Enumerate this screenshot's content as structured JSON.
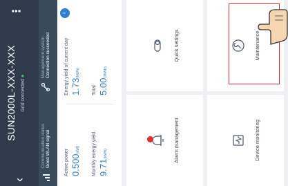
{
  "header": {
    "device_name": "SUN2000L-XXX-XXX",
    "grid_status": "Grid connected"
  },
  "status_bar": {
    "communication_label": "Communication status",
    "communication_value": "Good WLAN signal",
    "management_label": "Management system",
    "management_value": "Connection succeeded"
  },
  "energy": {
    "active_power_label": "Active power",
    "active_power_value": "0.500",
    "active_power_unit": "(kW)",
    "energy_today_label": "Energy yield of current day",
    "energy_today_value": "1.73",
    "energy_today_unit": "(kWh)",
    "monthly_label": "Monthly energy yield",
    "monthly_value": "9.71",
    "monthly_unit": "(kWh)",
    "total_label": "Total",
    "total_value": "5.00",
    "total_unit": "(MWh)",
    "badge_symbol": "i"
  },
  "tiles": {
    "alarm_management": "Alarm management",
    "quick_settings": "Quick settings",
    "device_monitoring": "Device monitoring",
    "maintenance": "Maintenance"
  },
  "icons": [
    "back-icon",
    "more-icon",
    "wlan-signal-icon",
    "link-icon",
    "alarm-icon",
    "quick-settings-icon",
    "device-monitoring-icon",
    "maintenance-icon",
    "pointing-hand-icon"
  ],
  "colors": {
    "header_bg": "#2f3b4c",
    "accent": "#2e7fd0",
    "alert": "#e32b2b",
    "ok": "#3ec46d"
  }
}
